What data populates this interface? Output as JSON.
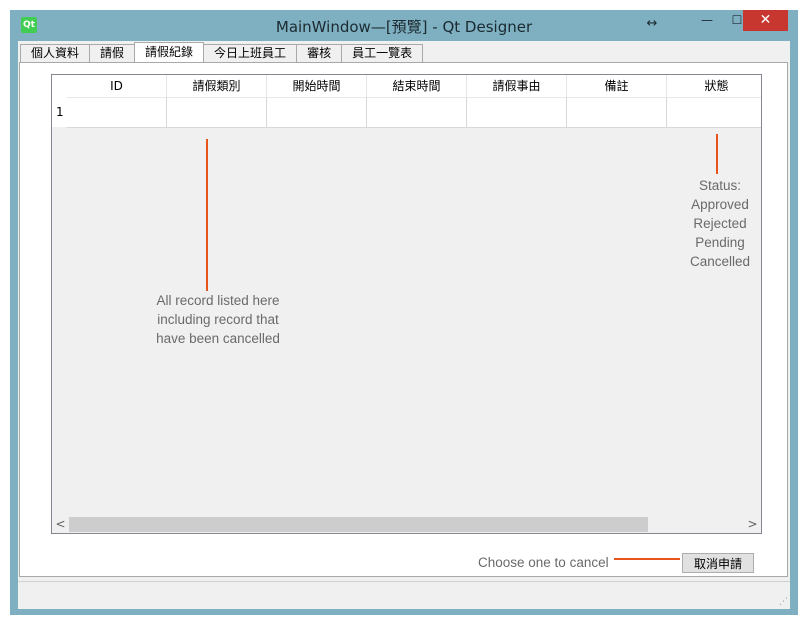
{
  "window": {
    "app_icon": "qt-logo-icon",
    "app_icon_text": "Qt",
    "title": "MainWindow—[預覽] - Qt Designer",
    "resize_glyph": "↔",
    "minimize_glyph": "—",
    "maximize_glyph": "☐",
    "close_glyph": "✕"
  },
  "tabs": [
    {
      "label": "個人資料"
    },
    {
      "label": "請假"
    },
    {
      "label": "請假紀錄",
      "active": true
    },
    {
      "label": "今日上班員工"
    },
    {
      "label": "審核"
    },
    {
      "label": "員工一覽表"
    }
  ],
  "table": {
    "columns": [
      "ID",
      "請假類別",
      "開始時間",
      "結束時間",
      "請假事由",
      "備註",
      "狀態"
    ],
    "row_headers": [
      "1"
    ],
    "rows": [
      [
        "",
        "",
        "",
        "",
        "",
        "",
        ""
      ]
    ],
    "scroll_left_glyph": "<",
    "scroll_right_glyph": ">"
  },
  "annotations": {
    "records": [
      "All record listed here",
      "including record that",
      "have been cancelled"
    ],
    "status": [
      "Status:",
      "Approved",
      "Rejected",
      "Pending",
      "Cancelled"
    ],
    "cancel_hint": "Choose one to cancel"
  },
  "buttons": {
    "cancel_request": "取消申請"
  },
  "colors": {
    "annotation_line": "#e8551c",
    "window_frame": "#7fb0c1",
    "close_button": "#c7372f"
  }
}
